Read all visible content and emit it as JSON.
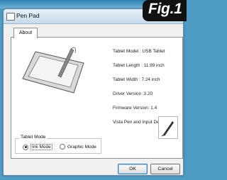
{
  "window": {
    "title": "Pen Pad"
  },
  "badge": {
    "label": "Fig.1"
  },
  "tabs": [
    {
      "label": "About"
    }
  ],
  "device_info": [
    "Tablet Model : USB Tablet",
    "Tablet Length : 11.99 inch",
    "Tablet Width : 7.24 inch",
    "Driver Version :3.20",
    "Firmware Version: 1.4",
    "Vista Pen and Input Device:"
  ],
  "tablet_mode": {
    "legend": "Tablet Mode",
    "options": [
      {
        "label": "Ink Mode",
        "selected": true
      },
      {
        "label": "Graphic Mode",
        "selected": false
      }
    ]
  },
  "buttons": {
    "ok": "OK",
    "cancel": "Cancel"
  },
  "colors": {
    "desktop": "#4e9bc4",
    "badge": "#111111",
    "accent": "#3c7fb1"
  }
}
